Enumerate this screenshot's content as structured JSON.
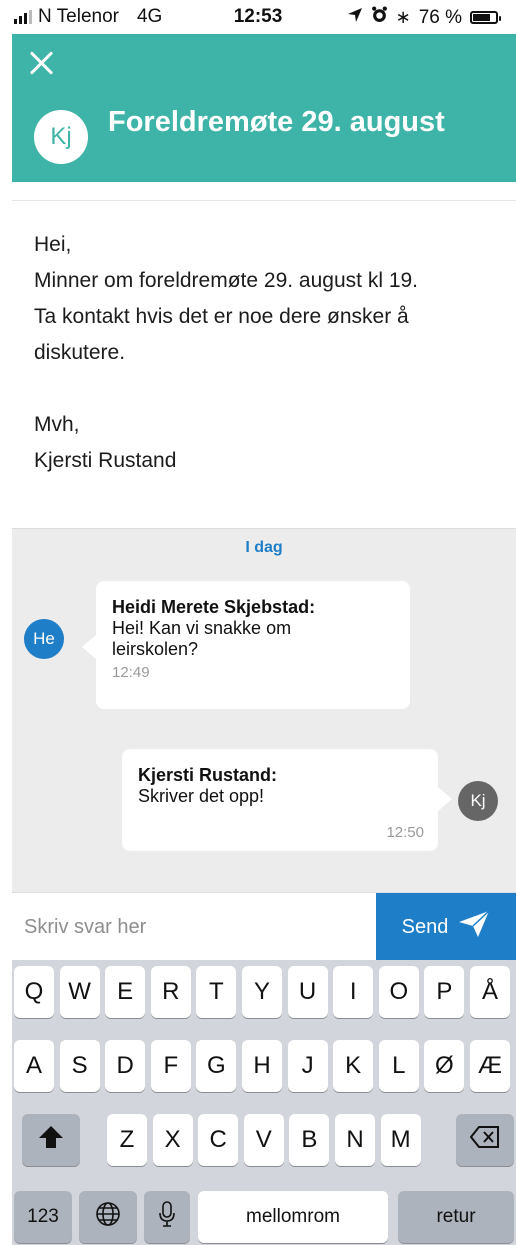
{
  "status_bar": {
    "carrier": "N Telenor",
    "network": "4G",
    "time": "12:53",
    "battery_text": "76 %",
    "battery_level": 0.76
  },
  "header": {
    "avatar_initials": "Kj",
    "title": "Foreldremøte 29. august",
    "color": "#3eb4a8"
  },
  "message": {
    "lines": [
      "Hei,",
      "Minner om foreldremøte 29. august kl 19.",
      "Ta kontakt hvis det er noe dere ønsker å",
      "diskutere."
    ],
    "closing": "Mvh,",
    "signature": "Kjersti Rustand"
  },
  "chat": {
    "date_label": "I dag",
    "messages": [
      {
        "avatar": "He",
        "sender": "Heidi Merete Skjebstad:",
        "text_lines": [
          "Hei! Kan vi snakke om",
          "leirskolen?"
        ],
        "time": "12:49"
      },
      {
        "avatar": "Kj",
        "sender": "Kjersti Rustand:",
        "text_lines": [
          "Skriver det opp!"
        ],
        "time": "12:50"
      }
    ]
  },
  "reply": {
    "placeholder": "Skriv svar her",
    "send_label": "Send",
    "accent": "#1e7ec8"
  },
  "keyboard": {
    "row1": [
      "Q",
      "W",
      "E",
      "R",
      "T",
      "Y",
      "U",
      "I",
      "O",
      "P",
      "Å"
    ],
    "row2": [
      "A",
      "S",
      "D",
      "F",
      "G",
      "H",
      "J",
      "K",
      "L",
      "Ø",
      "Æ"
    ],
    "row3": [
      "Z",
      "X",
      "C",
      "V",
      "B",
      "N",
      "M"
    ],
    "numbers_label": "123",
    "space_label": "mellomrom",
    "return_label": "retur",
    "icons": {
      "shift": "shift-icon",
      "backspace": "backspace-icon",
      "globe": "globe-icon",
      "mic": "microphone-icon"
    }
  }
}
